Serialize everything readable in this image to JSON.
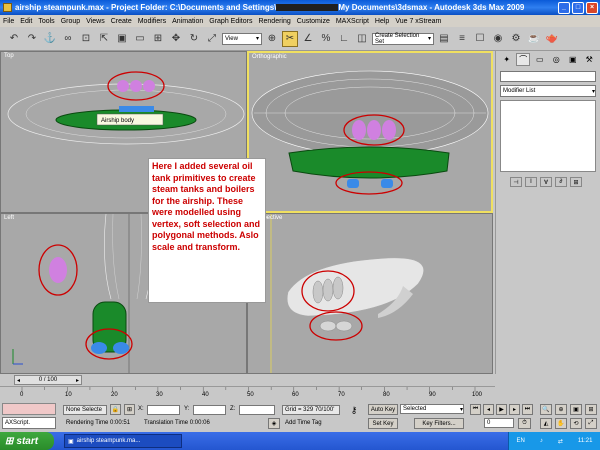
{
  "window": {
    "title_pre": "airship steampunk.max   - Project Folder: C:\\Documents and Settings\\",
    "title_post": "My Documents\\3dsmax   - Autodesk 3ds Max  2009",
    "buttons": {
      "min": "_",
      "max": "□",
      "close": "×"
    }
  },
  "menu": [
    "File",
    "Edit",
    "Tools",
    "Group",
    "Views",
    "Create",
    "Modifiers",
    "Animation",
    "Graph Editors",
    "Rendering",
    "Customize",
    "MAXScript",
    "Help",
    "Vue 7 xStream"
  ],
  "toolbar": {
    "view_select": "View",
    "selection_set_placeholder": "Create Selection Set",
    "icons": [
      "↶",
      "↷",
      "⚓",
      "∞",
      "⊡",
      "⇱",
      "▣",
      "▭",
      "⊞",
      "✥",
      "↻",
      "⤢",
      "⊕",
      "✂",
      "∠",
      "%",
      "∟",
      "◫",
      "▤",
      "≡",
      "☐",
      "◉",
      "⚙",
      "☕",
      "🫖"
    ]
  },
  "viewports": {
    "top": {
      "label": "Top",
      "tooltip": "Airship body"
    },
    "front": {
      "label": "Orthographic"
    },
    "left": {
      "label": "Left"
    },
    "persp": {
      "label": "Perspective"
    }
  },
  "annotation": {
    "text": "Here I added several oil tank primitives to create steam tanks and boilers for the airship. These were modelled using vertex, soft selection and polygonal methods. Aslo scale and transform."
  },
  "command_panel": {
    "tabs": [
      "✦",
      "⌒",
      "▭",
      "◎",
      "▣",
      "⚒"
    ],
    "modifier_list": "Modifier List",
    "stack_buttons": [
      "⊣",
      "I",
      "∀",
      "∂",
      "⊞"
    ]
  },
  "timeline": {
    "frame_display": "0 / 100",
    "ticks": [
      "0",
      "10",
      "20",
      "30",
      "40",
      "50",
      "60",
      "70",
      "80",
      "90",
      "100"
    ]
  },
  "status": {
    "maxscript_label": "AXScript.",
    "selection": "None Selecte",
    "x_label": "X:",
    "y_label": "Y:",
    "z_label": "Z:",
    "grid": "Grid = 329 70/100'",
    "rendering_time": "Rendering Time  0:00:51",
    "translation_time": "Translation Time  0:00:06",
    "add_time_tag": "Add Time Tag",
    "auto_key": "Auto Key",
    "set_key": "Set Key",
    "key_mode": "Selected",
    "key_filters": "Key Filters...",
    "frame_value": "0",
    "play_controls": [
      "⏮",
      "◂",
      "▶",
      "▸",
      "⏭"
    ]
  },
  "taskbar": {
    "start": "start",
    "task": "airship steampunk.ma...",
    "lang": "EN",
    "time": "11:21"
  }
}
